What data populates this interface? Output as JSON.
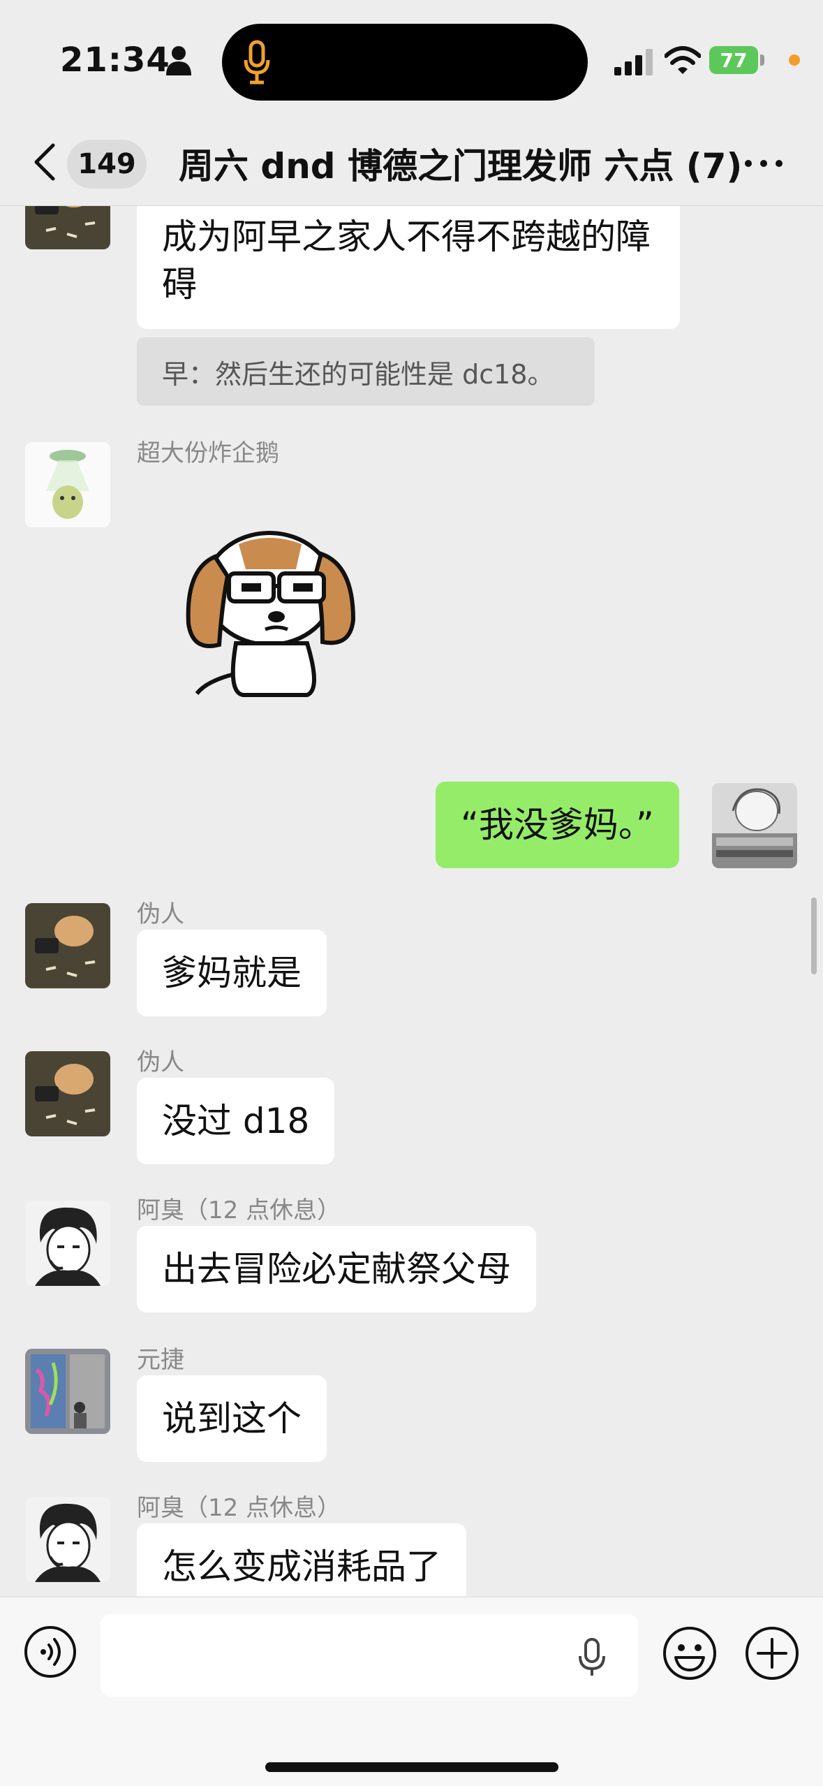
{
  "status_bar": {
    "time": "21:34",
    "battery": "77",
    "icons": [
      "person-icon",
      "microphone-icon",
      "signal-icon",
      "wifi-icon",
      "battery-icon"
    ]
  },
  "header": {
    "unread_count": "149",
    "title": "周六 dnd 博德之门理发师 六点 (7)",
    "icons": [
      "back-chevron-icon",
      "more-icon"
    ]
  },
  "messages": {
    "m0_text_line1": "成为阿早之家人不得不跨越的障",
    "m0_text_line2": "碍",
    "m0_quote": "早：然后生还的可能性是 dc18。",
    "m1_sender": "超大份炸企鹅",
    "m1_sticker": "beagle-glasses-sticker",
    "m2_text": "“我没爹妈。”",
    "m3_sender": "伪人",
    "m3_text": "爹妈就是",
    "m4_sender": "伪人",
    "m4_text": "没过 d18",
    "m5_sender": "阿臭（12 点休息）",
    "m5_text": "出去冒险必定献祭父母",
    "m6_sender": "元捷",
    "m6_text": "说到这个",
    "m7_sender": "阿臭（12 点休息）",
    "m7_text": "怎么变成消耗品了"
  },
  "input_bar": {
    "value": "",
    "icons": [
      "voice-toggle-icon",
      "microphone-icon",
      "emoji-icon",
      "plus-icon"
    ]
  },
  "colors": {
    "background": "#ededed",
    "bubble_incoming": "#ffffff",
    "bubble_outgoing": "#95ec69",
    "battery": "#5cc85a"
  }
}
